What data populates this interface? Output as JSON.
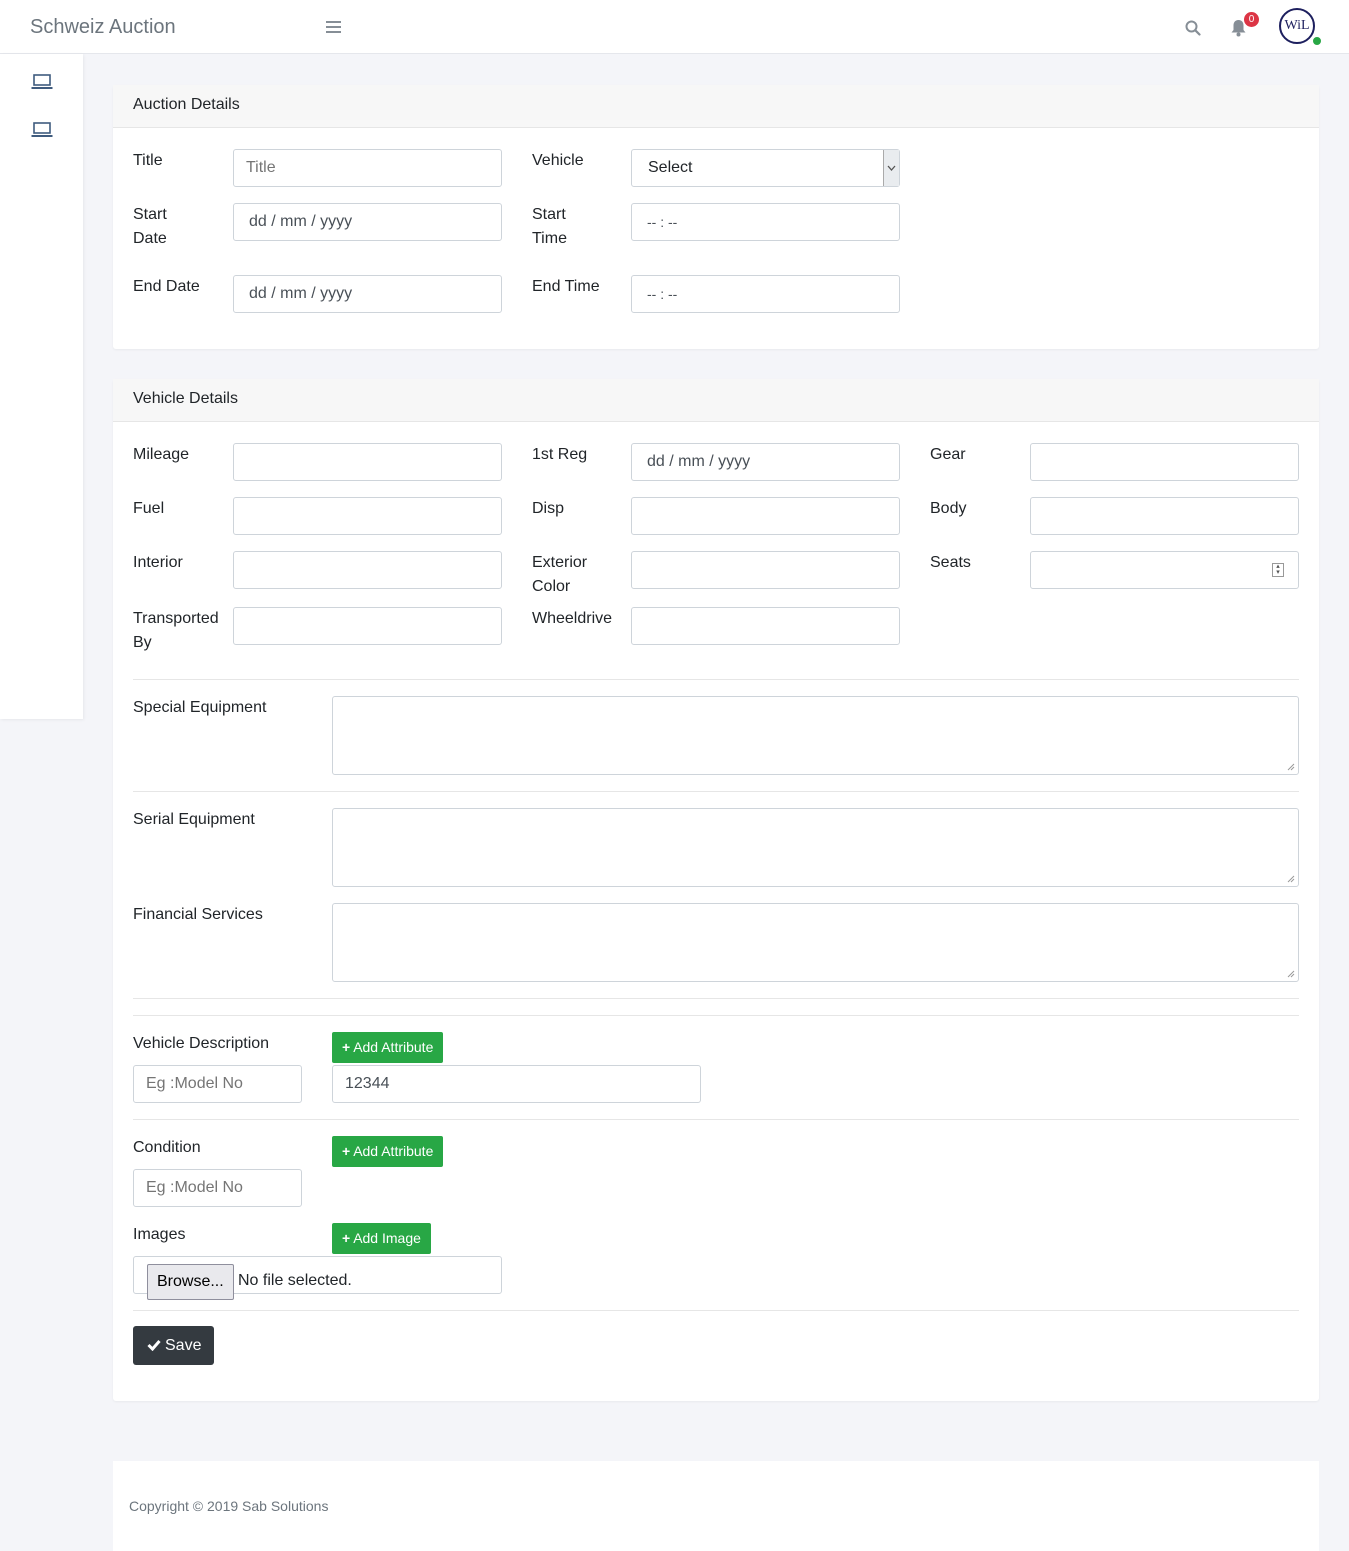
{
  "app": {
    "brand": "Schweiz Auction",
    "notification_count": "0",
    "avatar_initials": "WiL"
  },
  "auction": {
    "header": "Auction Details",
    "title_label": "Title",
    "title_placeholder": "Title",
    "vehicle_label": "Vehicle",
    "vehicle_selected": "Select",
    "start_date_label": "Start Date",
    "start_date_value": "dd / mm / yyyy",
    "start_time_label": "Start Time",
    "start_time_value": "-- : --",
    "end_date_label": "End Date",
    "end_date_value": "dd / mm / yyyy",
    "end_time_label": "End Time",
    "end_time_value": "-- : --"
  },
  "vehicle": {
    "header": "Vehicle Details",
    "mileage_label": "Mileage",
    "first_reg_label": "1st Reg",
    "first_reg_value": "dd / mm / yyyy",
    "gear_label": "Gear",
    "fuel_label": "Fuel",
    "disp_label": "Disp",
    "body_label": "Body",
    "interior_label": "Interior",
    "exterior_color_label": "Exterior Color",
    "seats_label": "Seats",
    "transported_by_label": "Transported By",
    "wheeldrive_label": "Wheeldrive",
    "special_equipment_label": "Special Equipment",
    "serial_equipment_label": "Serial Equipment",
    "financial_services_label": "Financial Services",
    "vehicle_description_label": "Vehicle Description",
    "vehicle_description_placeholder": "Eg :Model No",
    "vehicle_description_value": "12344",
    "condition_label": "Condition",
    "condition_placeholder": "Eg :Model No",
    "add_attribute_label": "Add Attribute",
    "images_label": "Images",
    "add_image_label": "Add Image",
    "browse_label": "Browse...",
    "no_file_label": "No file selected.",
    "save_label": "Save"
  },
  "footer": {
    "copyright": "Copyright © 2019 Sab Solutions"
  },
  "icons": {
    "menu": "hamburger-menu-icon",
    "search": "search-icon",
    "bell": "bell-icon",
    "nav": "laptop-icon",
    "plus": "plus-icon",
    "check": "check-icon"
  }
}
